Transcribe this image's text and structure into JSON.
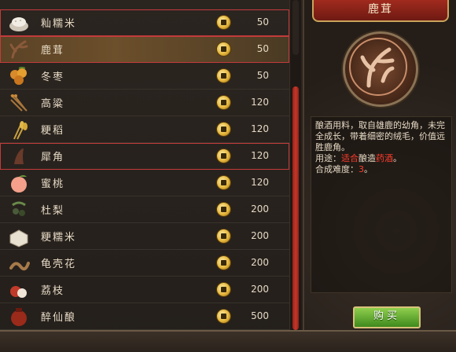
{
  "items": [
    {
      "name": "籼糯米",
      "price": "50",
      "icon": "rice-bowl-icon"
    },
    {
      "name": "鹿茸",
      "price": "50",
      "icon": "antler-icon"
    },
    {
      "name": "冬枣",
      "price": "50",
      "icon": "jujube-icon"
    },
    {
      "name": "高粱",
      "price": "120",
      "icon": "sorghum-icon"
    },
    {
      "name": "粳稻",
      "price": "120",
      "icon": "rice-stalk-icon"
    },
    {
      "name": "犀角",
      "price": "120",
      "icon": "rhino-horn-icon"
    },
    {
      "name": "蜜桃",
      "price": "120",
      "icon": "peach-icon"
    },
    {
      "name": "杜梨",
      "price": "200",
      "icon": "pear-icon"
    },
    {
      "name": "粳糯米",
      "price": "200",
      "icon": "rice-sack-icon"
    },
    {
      "name": "龟壳花",
      "price": "200",
      "icon": "snake-icon"
    },
    {
      "name": "荔枝",
      "price": "200",
      "icon": "lychee-icon"
    },
    {
      "name": "醉仙酿",
      "price": "500",
      "icon": "wine-jar-icon"
    }
  ],
  "detail": {
    "title": "鹿茸",
    "desc1": "酿酒用料，取自雄鹿的幼角，未完全成长，带着细密的绒毛，价值远胜鹿角。",
    "use_label": "用途：",
    "use_red1": "适合",
    "use_mid": "酿造",
    "use_red2": "药酒",
    "use_end": "。",
    "difficulty_label": "合成难度：",
    "difficulty_value": "3",
    "difficulty_end": "。"
  },
  "buy_label": "购买",
  "colors": {
    "accent_red": "#c23b3b",
    "gold": "#e5b53a",
    "buy_green": "#5aa82a"
  }
}
